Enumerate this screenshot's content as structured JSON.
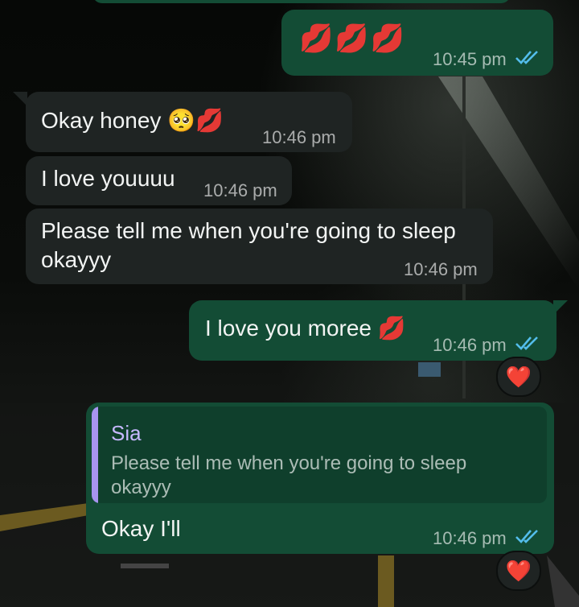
{
  "chat": {
    "messages": [
      {
        "id": "m1",
        "direction": "outgoing",
        "text": "💋💋💋",
        "time": "10:45 pm",
        "status": "read"
      },
      {
        "id": "m2",
        "direction": "incoming",
        "text": "Okay honey 🥺💋",
        "time": "10:46 pm"
      },
      {
        "id": "m3",
        "direction": "incoming",
        "text": "I love youuuu",
        "time": "10:46 pm"
      },
      {
        "id": "m4",
        "direction": "incoming",
        "text_line1": "Please tell me when you're going to sleep",
        "text_line2": "okayyy",
        "time": "10:46 pm"
      },
      {
        "id": "m5",
        "direction": "outgoing",
        "text": "I love you moree 💋",
        "time": "10:46 pm",
        "status": "read",
        "reaction": "❤️"
      },
      {
        "id": "m6",
        "direction": "outgoing",
        "reply_to": {
          "sender": "Sia",
          "text": "Please tell me when you're going to sleep okayyy"
        },
        "text": "Okay I'll",
        "time": "10:46 pm",
        "status": "read",
        "reaction": "❤️"
      }
    ]
  },
  "colors": {
    "incoming_bubble": "#1f2423",
    "outgoing_bubble": "#134c35",
    "read_ticks": "#53bdeb",
    "quote_accent": "#a794f0"
  },
  "icons": [
    "kiss-mark-icon",
    "pleading-face-icon",
    "double-check-icon",
    "heart-icon"
  ]
}
